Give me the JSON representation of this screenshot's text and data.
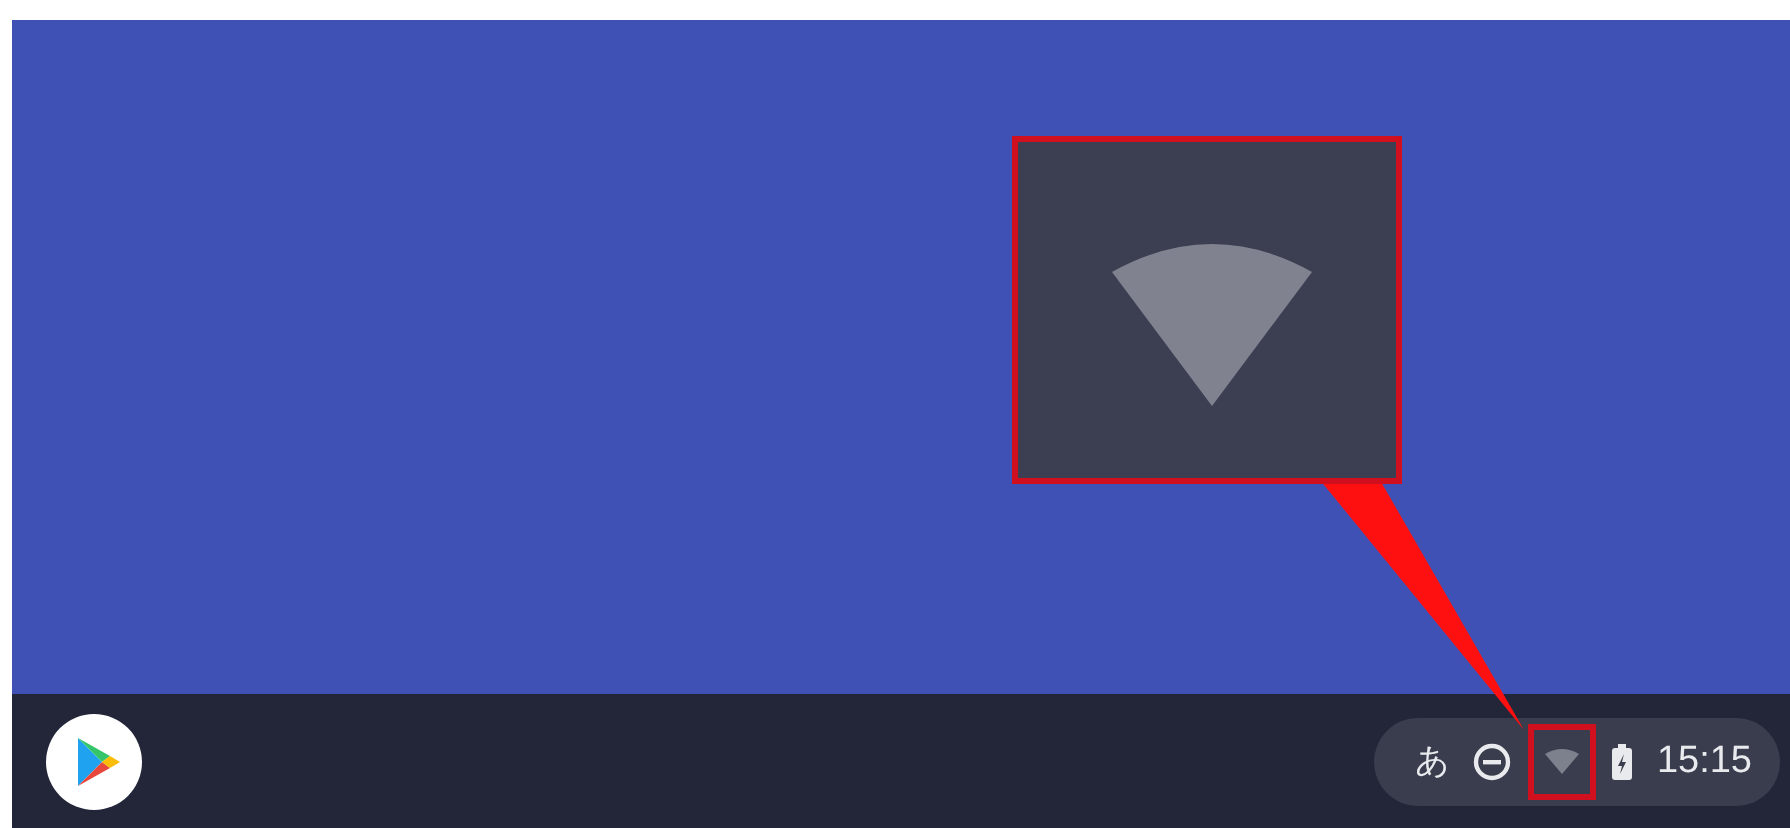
{
  "shelf": {
    "apps": [
      {
        "kind": "play"
      }
    ]
  },
  "tray": {
    "ime": "あ",
    "time": "15:15"
  }
}
